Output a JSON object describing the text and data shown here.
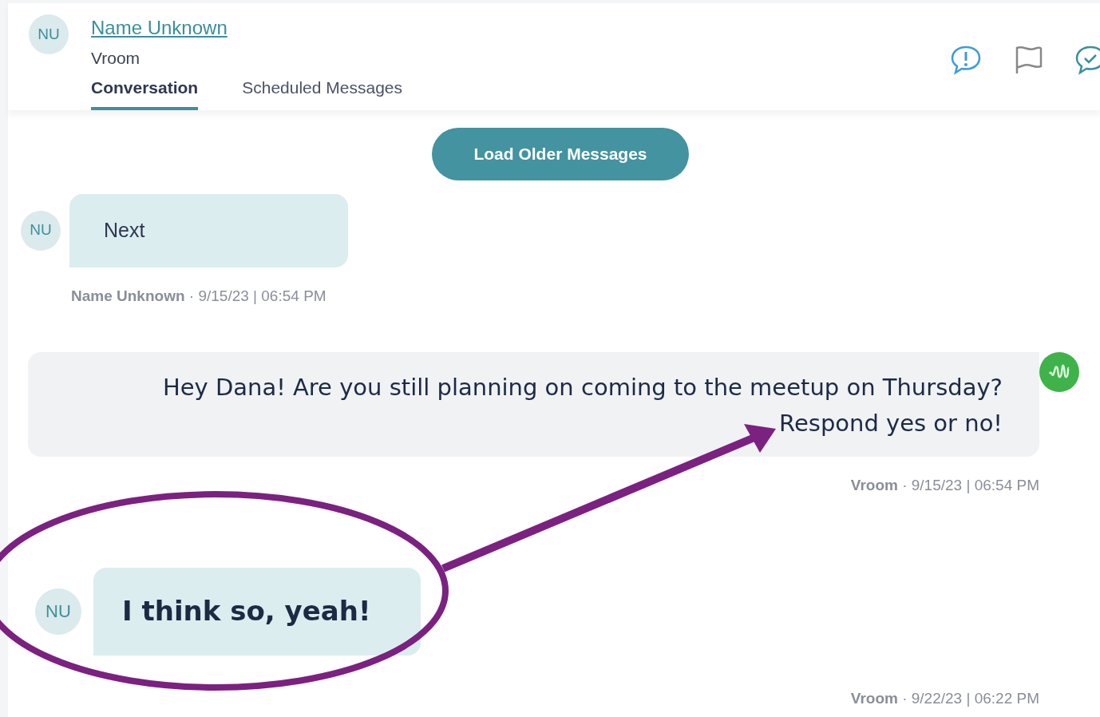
{
  "header": {
    "avatar": "NU",
    "contact_name": "Name Unknown",
    "organization": "Vroom",
    "tabs": [
      {
        "label": "Conversation",
        "selected": true
      },
      {
        "label": "Scheduled Messages",
        "selected": false
      }
    ]
  },
  "load_button": "Load Older Messages",
  "messages": [
    {
      "kind": "incoming",
      "avatar": "NU",
      "text": "Next",
      "meta": "**Name Unknown** · 9/15/23 | 06:54 PM"
    },
    {
      "kind": "outgoing",
      "text": "Hey Dana! Are you still planning on coming to the meetup on Thursday? Respond yes or no!",
      "meta": "**Vroom** · 9/15/23 | 06:54 PM"
    },
    {
      "kind": "incoming_large",
      "avatar": "NU",
      "text": "I think so, yeah!",
      "meta": "**Vroom** · 9/22/23 | 06:22 PM"
    }
  ]
}
